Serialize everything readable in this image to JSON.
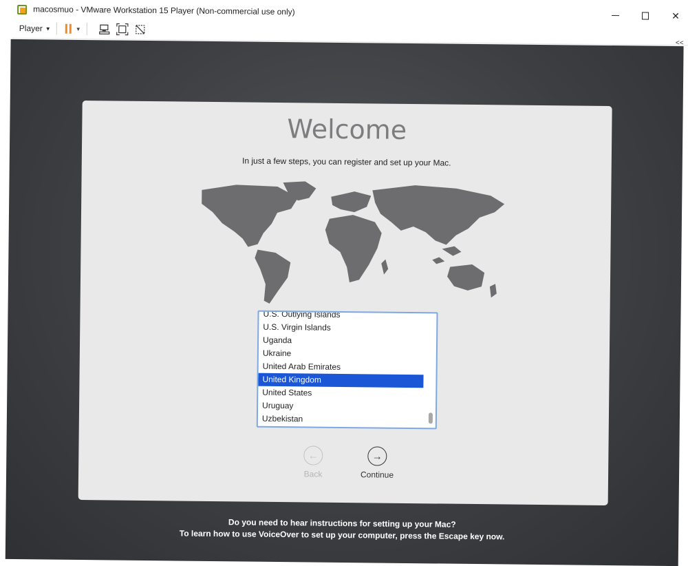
{
  "window": {
    "title": "macosmuo - VMware Workstation 15 Player (Non-commercial use only)",
    "minimize_glyph": "",
    "close_glyph": "✕"
  },
  "toolbar": {
    "player_label": "Player",
    "collapse_glyph": "<<"
  },
  "setup": {
    "title": "Welcome",
    "subtitle": "In just a few steps, you can register and set up your Mac.",
    "countries": [
      "U.S. Outlying Islands",
      "U.S. Virgin Islands",
      "Uganda",
      "Ukraine",
      "United Arab Emirates",
      "United Kingdom",
      "United States",
      "Uruguay",
      "Uzbekistan"
    ],
    "selected_country": "United Kingdom",
    "back_label": "Back",
    "continue_label": "Continue",
    "back_arrow": "←",
    "continue_arrow": "→"
  },
  "voiceover": {
    "line1": "Do you need to hear instructions for setting up your Mac?",
    "line2": "To learn how to use VoiceOver to set up your computer, press the Escape key now."
  },
  "colors": {
    "selection": "#1a56d6",
    "pause_accent": "#f28b20",
    "panel_bg": "#e9e9ea",
    "vm_bg": "#3d3f43"
  }
}
